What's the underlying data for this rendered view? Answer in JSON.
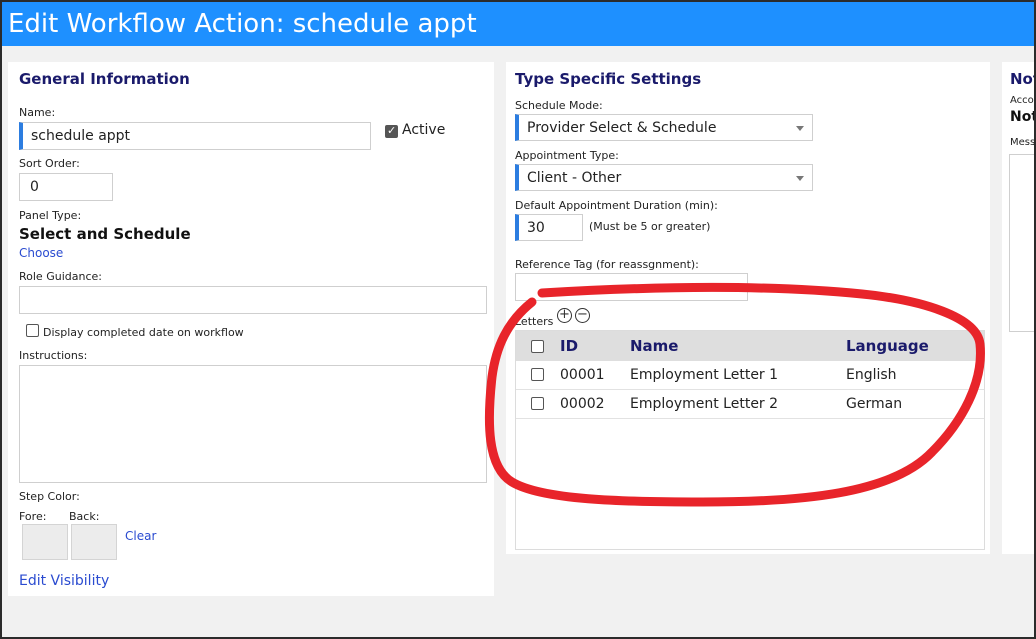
{
  "window": {
    "title": "Edit Workflow Action: schedule appt"
  },
  "general": {
    "heading": "General Information",
    "name_label": "Name:",
    "name_value": "schedule appt",
    "active_label": "Active",
    "sort_order_label": "Sort Order:",
    "sort_order_value": "0",
    "panel_type_label": "Panel Type:",
    "panel_type_value": "Select and Schedule",
    "choose_link": "Choose",
    "role_guidance_label": "Role Guidance:",
    "role_guidance_value": "",
    "display_completed_label": "Display completed date on workflow",
    "instructions_label": "Instructions:",
    "step_color_label": "Step Color:",
    "fore_label": "Fore:",
    "back_label": "Back:",
    "clear_link": "Clear",
    "edit_visibility_link": "Edit Visibility"
  },
  "type_specific": {
    "heading": "Type Specific Settings",
    "schedule_mode_label": "Schedule Mode:",
    "schedule_mode_value": "Provider Select & Schedule",
    "appointment_type_label": "Appointment Type:",
    "appointment_type_value": "Client - Other",
    "duration_label": "Default Appointment Duration (min):",
    "duration_value": "30",
    "duration_note": "(Must be 5 or greater)",
    "reference_tag_label": "Reference Tag (for reassgnment):",
    "reference_tag_value": "",
    "letters_label": "Letters",
    "letters_columns": [
      "ID",
      "Name",
      "Language"
    ],
    "letters_rows": [
      {
        "id": "00001",
        "name": "Employment Letter 1",
        "language": "English"
      },
      {
        "id": "00002",
        "name": "Employment Letter 2",
        "language": "German"
      }
    ]
  },
  "right_panel": {
    "heading": "Not",
    "acc_label": "Acco",
    "value": "Not",
    "mess_label": "Mess"
  },
  "annotation": {
    "color": "#e8242a"
  }
}
